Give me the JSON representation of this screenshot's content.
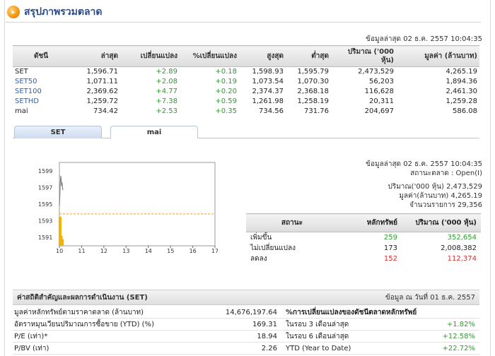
{
  "header": {
    "title": "สรุปภาพรวมตลาด",
    "icon": "arrow-orb-icon"
  },
  "market": {
    "updated": "ข้อมูลล่าสุด 02 ธ.ค. 2557 10:04:35",
    "columns": [
      "ดัชนี",
      "ล่าสุด",
      "เปลี่ยนแปลง",
      "%เปลี่ยนแปลง",
      "สูงสุด",
      "ต่ำสุด",
      "ปริมาณ ('000 หุ้น)",
      "มูลค่า (ล้านบาท)"
    ],
    "rows": [
      {
        "name": "SET",
        "last": "1,596.71",
        "chg": "+2.89",
        "pct": "+0.18",
        "high": "1,598.93",
        "low": "1,595.79",
        "vol": "2,473,529",
        "value": "4,265.19"
      },
      {
        "name": "SET50",
        "last": "1,071.11",
        "chg": "+2.08",
        "pct": "+0.19",
        "high": "1,073.54",
        "low": "1,070.30",
        "vol": "56,203",
        "value": "1,894.36"
      },
      {
        "name": "SET100",
        "last": "2,369.62",
        "chg": "+4.77",
        "pct": "+0.20",
        "high": "2,374.37",
        "low": "2,368.18",
        "vol": "116,628",
        "value": "2,461.30"
      },
      {
        "name": "SETHD",
        "last": "1,259.72",
        "chg": "+7.38",
        "pct": "+0.59",
        "high": "1,261.98",
        "low": "1,258.19",
        "vol": "20,311",
        "value": "1,259.28"
      },
      {
        "name": "mai",
        "last": "734.42",
        "chg": "+2.53",
        "pct": "+0.35",
        "high": "734.56",
        "low": "731.76",
        "vol": "204,697",
        "value": "586.08"
      }
    ]
  },
  "tabs": [
    {
      "label": "SET"
    },
    {
      "label": "mai"
    }
  ],
  "detail": {
    "updated": "ข้อมูลล่าสุด 02 ธ.ค. 2557 10:04:35",
    "status": "สถานะตลาด : Open(I)",
    "volume": "ปริมาณ('000 หุ้น) 2,473,529",
    "value": "มูลค่า(ล้านบาท) 4,265.19",
    "trades": "จำนวนรายการ 29,356"
  },
  "chart_data": {
    "type": "line",
    "title": "",
    "xlabel": "",
    "ylabel": "",
    "x_ticks": [
      "10",
      "11",
      "12",
      "13",
      "14",
      "15",
      "16",
      "17"
    ],
    "y_ticks": [
      "1599",
      "1597",
      "1595",
      "1593",
      "1591"
    ],
    "ylim": [
      1590,
      1600
    ],
    "xlim": [
      10,
      17
    ],
    "prev_close": 1593.82,
    "series": [
      {
        "x": [
          10.0,
          10.02,
          10.04,
          10.06,
          10.08,
          10.1,
          10.12,
          10.14,
          10.16
        ],
        "y": [
          1594.8,
          1596.2,
          1597.6,
          1598.4,
          1597.9,
          1597.2,
          1597.6,
          1596.9,
          1596.7
        ]
      }
    ],
    "volume_bars": [
      {
        "x": 10.03,
        "h": 0.35
      },
      {
        "x": 10.08,
        "h": 0.12
      },
      {
        "x": 10.13,
        "h": 0.08
      }
    ],
    "colors": {
      "line": "#7f7f7f",
      "prev_close": "#f0a020",
      "volume": "#f2b200"
    }
  },
  "advance": {
    "columns": [
      "สถานะ",
      "หลักทรัพย์",
      "ปริมาณ ('000 หุ้น)"
    ],
    "rows": [
      {
        "name": "เพิ่มขึ้น",
        "count": "259",
        "vol": "352,654",
        "cls": "green"
      },
      {
        "name": "ไม่เปลี่ยนแปลง",
        "count": "173",
        "vol": "2,008,382",
        "cls": ""
      },
      {
        "name": "ลดลง",
        "count": "152",
        "vol": "112,374",
        "cls": "red"
      }
    ]
  },
  "stats": {
    "title": "ค่าสถิติสำคัญและผลการดำเนินงาน (SET)",
    "date": "ข้อมูล ณ วันที่ 01 ธ.ค. 2557",
    "right_title": "%การเปลี่ยนแปลงของดัชนีตลาดหลักทรัพย์",
    "rows": [
      {
        "label": "มูลค่าหลักทรัพย์ตามราคาตลาด (ล้านบาท)",
        "value": "14,676,197.64",
        "label2": "%การเปลี่ยนแปลงของดัชนีตลาดหลักทรัพย์",
        "value2": ""
      },
      {
        "label": "อัตราหมุนเวียนปริมาณการซื้อขาย (YTD) (%)",
        "value": "169.31",
        "label2": "ในรอบ 3 เดือนล่าสุด",
        "value2": "+1.82%"
      },
      {
        "label": "P/E (เท่า)*",
        "value": "18.94",
        "label2": "ในรอบ 6 เดือนล่าสุด",
        "value2": "+12.58%"
      },
      {
        "label": "P/BV (เท่า)",
        "value": "2.26",
        "label2": "YTD (Year to Date)",
        "value2": "+22.72%"
      }
    ]
  }
}
